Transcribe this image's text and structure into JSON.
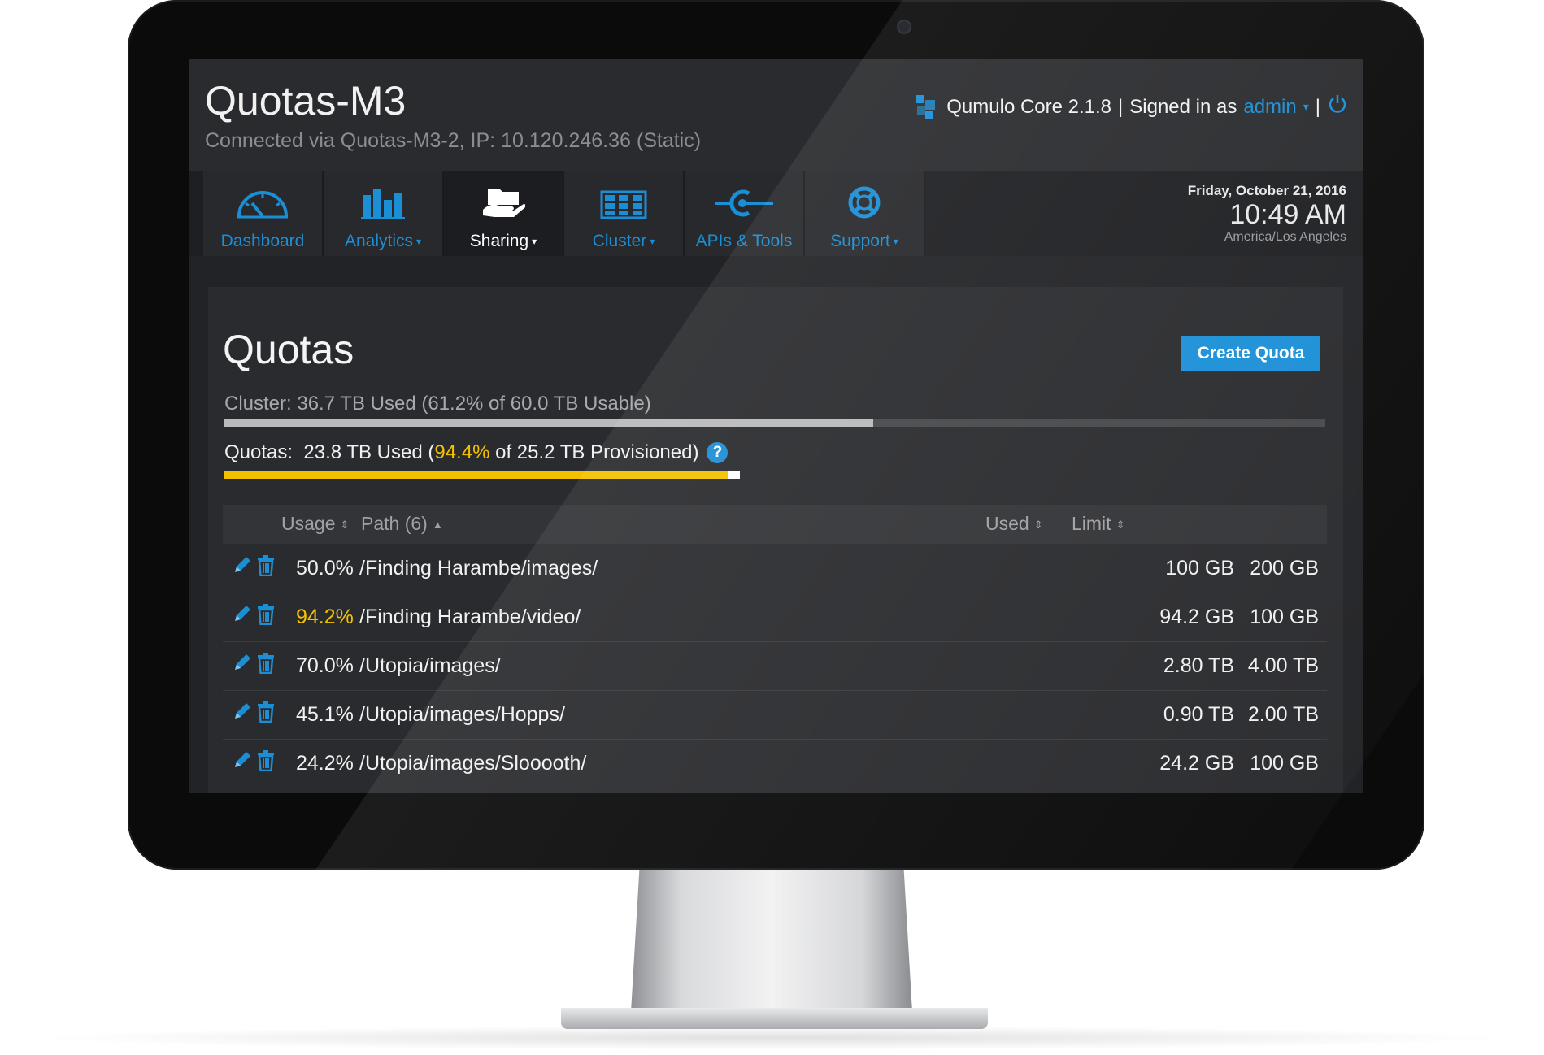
{
  "header": {
    "cluster_name": "Quotas-M3",
    "connection": "Connected via Quotas-M3-2, IP: 10.120.246.36 (Static)",
    "product": "Qumulo Core 2.1.8",
    "signed_in_prefix": "Signed in as",
    "user": "admin",
    "separator": "|"
  },
  "nav": {
    "tabs": [
      {
        "label": "Dashboard",
        "icon": "gauge-icon",
        "has_menu": false,
        "active": false
      },
      {
        "label": "Analytics",
        "icon": "bar-chart-icon",
        "has_menu": true,
        "active": false
      },
      {
        "label": "Sharing",
        "icon": "shared-folder-icon",
        "has_menu": true,
        "active": true
      },
      {
        "label": "Cluster",
        "icon": "server-grid-icon",
        "has_menu": true,
        "active": false
      },
      {
        "label": "APIs & Tools",
        "icon": "api-connector-icon",
        "has_menu": false,
        "active": false
      },
      {
        "label": "Support",
        "icon": "lifebuoy-icon",
        "has_menu": true,
        "active": false
      }
    ],
    "caret": "▾"
  },
  "datetime": {
    "date": "Friday, October 21, 2016",
    "time": "10:49 AM",
    "timezone": "America/Los Angeles"
  },
  "page": {
    "title": "Quotas",
    "create_button": "Create Quota",
    "cluster_usage": {
      "text": "Cluster:  36.7 TB Used (61.2% of 60.0 TB Usable)",
      "fraction": 0.589
    },
    "quota_usage": {
      "prefix": "Quotas:  23.8 TB Used (",
      "percent": "94.4%",
      "suffix": " of 25.2 TB Provisioned)",
      "fraction": 0.976
    },
    "help_label": "?"
  },
  "table": {
    "headers": {
      "usage": "Usage",
      "path": "Path (6)",
      "used": "Used",
      "limit": "Limit"
    },
    "sort_both": "⇕",
    "sort_up": "▲",
    "rows": [
      {
        "usage": "50.0%",
        "path": "/Finding Harambe/images/",
        "used": "100 GB",
        "limit": "200 GB",
        "warn": false
      },
      {
        "usage": "94.2%",
        "path": "/Finding Harambe/video/",
        "used": "94.2 GB",
        "limit": "100 GB",
        "warn": true
      },
      {
        "usage": "70.0%",
        "path": "/Utopia/images/",
        "used": "2.80 TB",
        "limit": "4.00 TB",
        "warn": false
      },
      {
        "usage": "45.1%",
        "path": "/Utopia/images/Hopps/",
        "used": "0.90 TB",
        "limit": "2.00 TB",
        "warn": false
      },
      {
        "usage": "24.2%",
        "path": "/Utopia/images/Slooooth/",
        "used": "24.2 GB",
        "limit": "100 GB",
        "warn": false
      }
    ]
  },
  "colors": {
    "accent": "#1b8fd6",
    "warning": "#f2c200",
    "background": "#222326"
  }
}
